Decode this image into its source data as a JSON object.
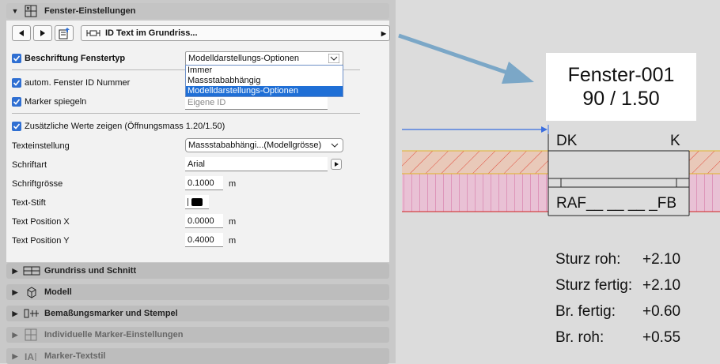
{
  "sections": {
    "window_settings": "Fenster-Einstellungen",
    "plan_section": "Grundriss und Schnitt",
    "model": "Modell",
    "dimension_markers": "Bemaßungsmarker und Stempel",
    "custom_marker": "Individuelle Marker-Einstellungen",
    "marker_textstyle": "Marker-Textstil"
  },
  "nav": {
    "path_label": "ID Text im Grundriss..."
  },
  "fields": {
    "label_window_type": "Beschriftung Fenstertyp",
    "label_window_type_value": "Modelldarstellungs-Optionen",
    "auto_window_id": "autom. Fenster ID Nummer",
    "mirror_marker": "Marker spiegeln",
    "own_id_placeholder": "Eigene ID",
    "show_extra_values": "Zusätzliche Werte zeigen (Öffnungsmass 1.20/1.50)",
    "text_setting_label": "Texteinstellung",
    "text_setting_value": "Massstababhängi...(Modellgrösse)",
    "font_label": "Schriftart",
    "font_value": "Arial",
    "font_size_label": "Schriftgrösse",
    "font_size_value": "0.1000",
    "text_pen_label": "Text-Stift",
    "text_pos_x_label": "Text Position X",
    "text_pos_x_value": "0.0000",
    "text_pos_y_label": "Text Position Y",
    "text_pos_y_value": "0.4000",
    "unit_m": "m"
  },
  "dropdown_options": [
    "Immer",
    "Massstabab­hängig",
    "Modelldarstellungs-Optionen"
  ],
  "dropdown_selected_index": 2,
  "drawing": {
    "tag_line1": "Fenster-001",
    "tag_line2": "90 / 1.50",
    "dk": "DK",
    "k": "K",
    "raf": "RAF__ __ __ _FB",
    "stats": [
      {
        "label": "Sturz roh:",
        "value": "+2.10"
      },
      {
        "label": "Sturz fertig:",
        "value": "+2.10"
      },
      {
        "label": "Br. fertig:",
        "value": "+0.60"
      },
      {
        "label": "Br. roh:",
        "value": "+0.55"
      }
    ]
  },
  "colors": {
    "accent": "#2f6fd2",
    "arrow": "#7ba7c7",
    "hatch_yellow": "#e0b429",
    "hatch_pink": "#d978a8"
  }
}
